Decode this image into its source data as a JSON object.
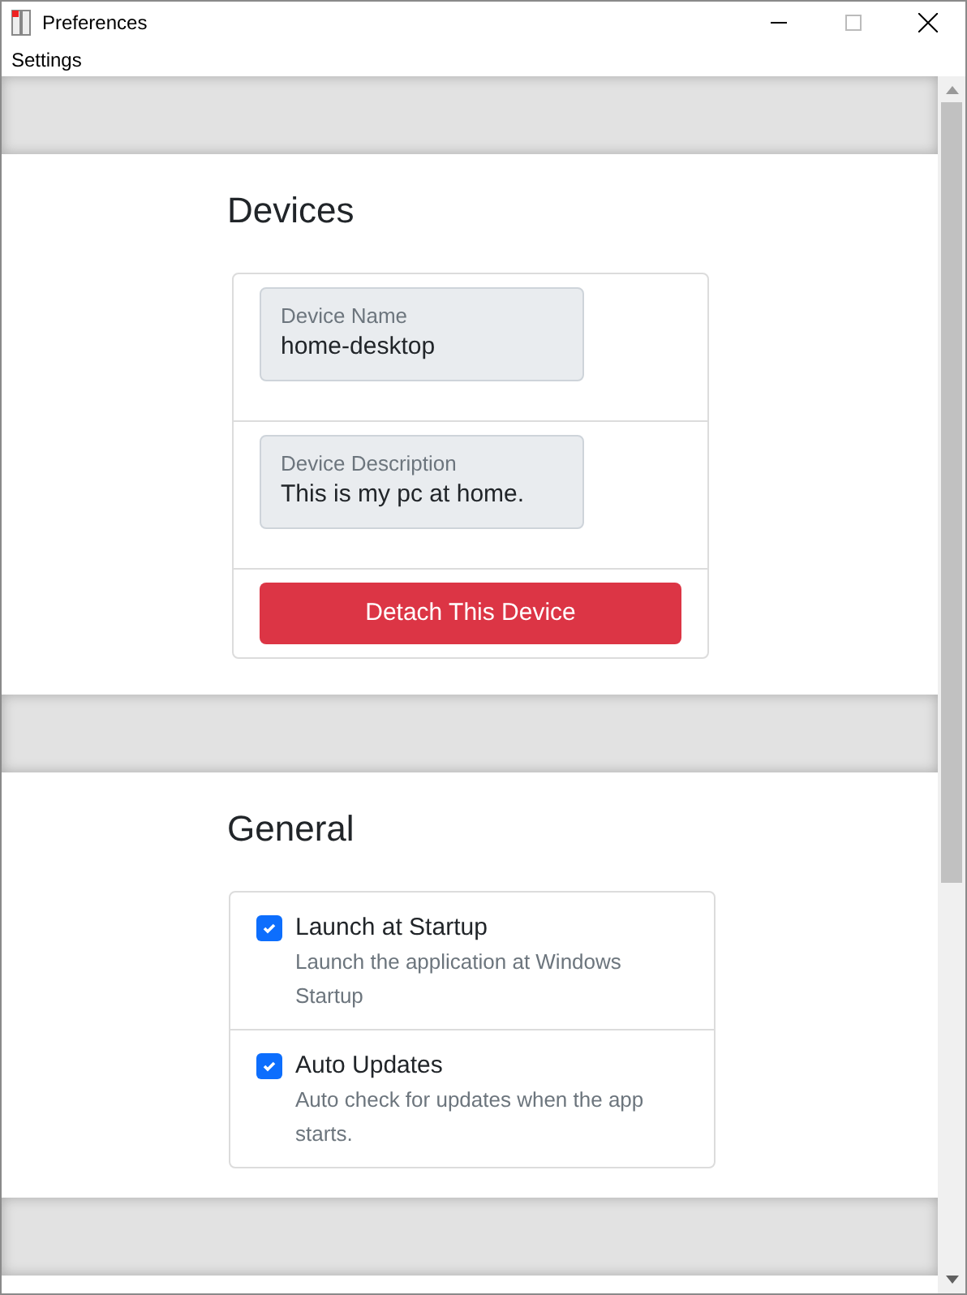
{
  "window": {
    "title": "Preferences"
  },
  "menu": [
    "Settings"
  ],
  "devices": {
    "heading": "Devices",
    "fields": [
      {
        "label": "Device Name",
        "value": "home-desktop"
      },
      {
        "label": "Device Description",
        "value": "This is my pc at home."
      }
    ],
    "button": "Detach This Device"
  },
  "general": {
    "heading": "General",
    "options": [
      {
        "label": "Launch at Startup",
        "description": "Launch the application at Windows Startup",
        "checked": true
      },
      {
        "label": "Auto Updates",
        "description": "Auto check for updates when the app starts.",
        "checked": true
      }
    ]
  }
}
